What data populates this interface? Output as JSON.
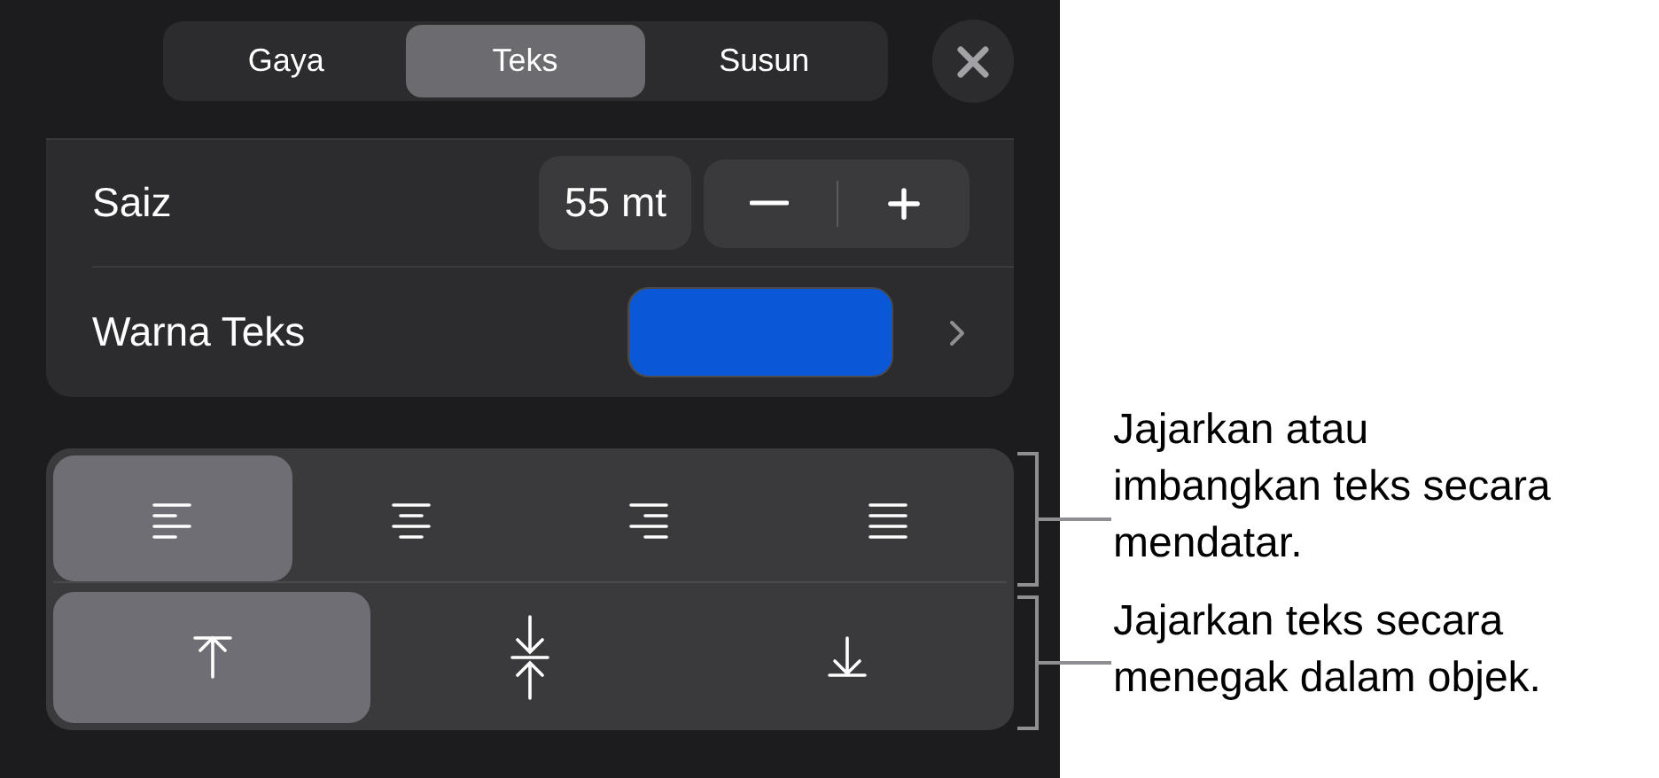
{
  "tabs": [
    {
      "label": "Gaya",
      "selected": false
    },
    {
      "label": "Teks",
      "selected": true
    },
    {
      "label": "Susun",
      "selected": false
    }
  ],
  "size": {
    "label": "Saiz",
    "value": "55 mt"
  },
  "text_color": {
    "label": "Warna Teks",
    "color": "#0a58d6"
  },
  "horizontal_align": [
    {
      "kind": "left",
      "selected": true
    },
    {
      "kind": "center",
      "selected": false
    },
    {
      "kind": "right",
      "selected": false
    },
    {
      "kind": "justify",
      "selected": false
    }
  ],
  "vertical_align": [
    {
      "kind": "top",
      "selected": true
    },
    {
      "kind": "middle",
      "selected": false
    },
    {
      "kind": "bottom",
      "selected": false
    }
  ],
  "callouts": [
    "Jajarkan atau imbangkan teks secara mendatar.",
    "Jajarkan teks secara menegak dalam objek."
  ]
}
